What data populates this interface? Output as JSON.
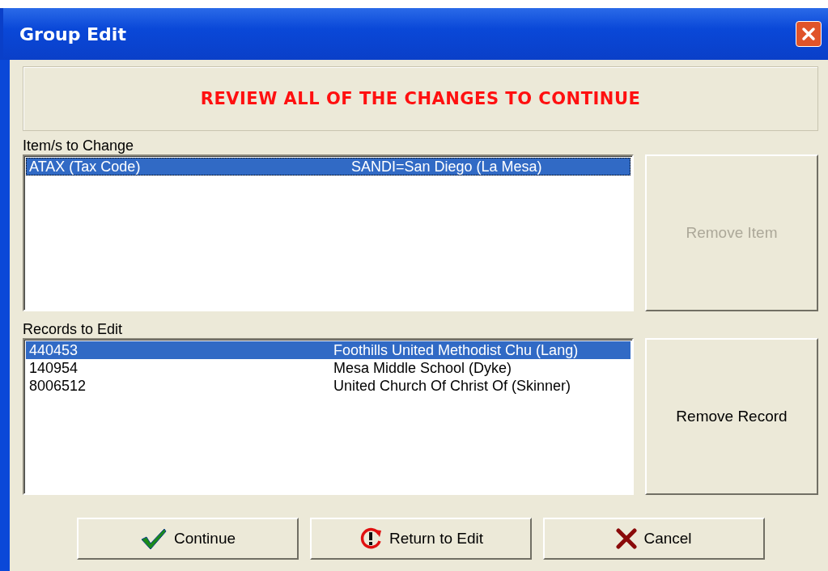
{
  "window": {
    "title": "Group Edit"
  },
  "banner": "REVIEW ALL OF THE CHANGES TO CONTINUE",
  "items_list": {
    "label": "Item/s to Change",
    "rows": [
      {
        "code": "ATAX (Tax Code)",
        "value": "SANDI=San Diego (La Mesa)",
        "selected": true
      }
    ]
  },
  "remove_item": {
    "label": "Remove Item",
    "disabled": true
  },
  "records_list": {
    "label": "Records to Edit",
    "rows": [
      {
        "code": "440453",
        "value": "Foothills United Methodist Chu (Lang)",
        "selected": true
      },
      {
        "code": "140954",
        "value": "Mesa Middle School (Dyke)",
        "selected": false
      },
      {
        "code": "8006512",
        "value": "United Church Of Christ Of (Skinner)",
        "selected": false
      }
    ]
  },
  "remove_record": {
    "label": "Remove Record",
    "disabled": false
  },
  "buttons": [
    {
      "label": "Continue",
      "kind": "check"
    },
    {
      "label": "Return to Edit",
      "kind": "return"
    },
    {
      "label": "Cancel",
      "kind": "cancel"
    }
  ]
}
